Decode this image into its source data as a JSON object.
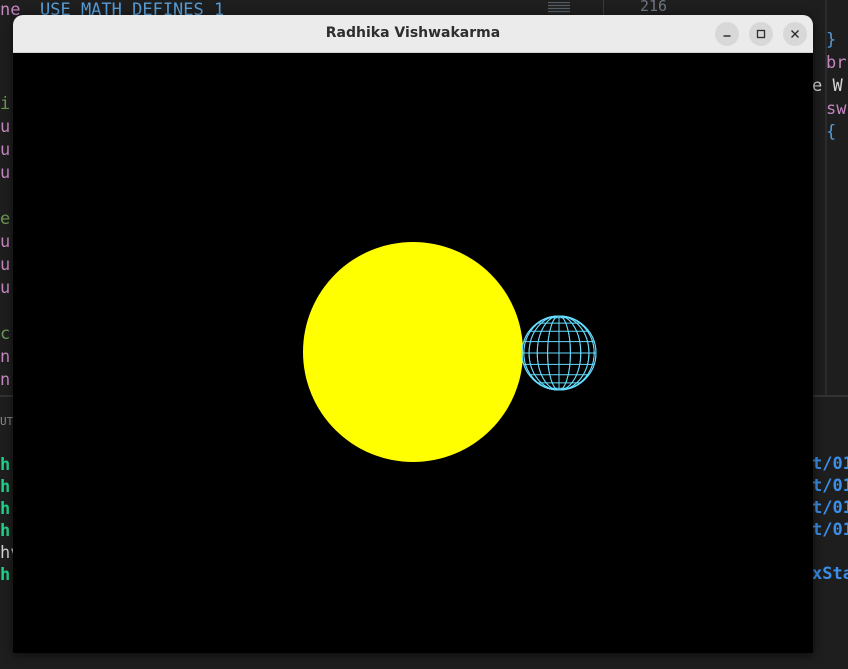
{
  "window": {
    "title": "Radhika Vishwakarma",
    "controls": {
      "minimize": "minimize-icon",
      "maximize": "maximize-icon",
      "close": "close-icon"
    }
  },
  "scene": {
    "background_color": "#000000",
    "sun": {
      "color": "#ffff00",
      "style": "solid"
    },
    "planet": {
      "color": "#66ddff",
      "style": "wireframe"
    }
  },
  "background_editor": {
    "top_line_fragments": [
      "ne",
      "USE MATH DEFINES 1"
    ],
    "top_right_number": "216",
    "left_fragments": [
      "u",
      "i",
      "u",
      "u",
      "u",
      "e",
      "u",
      "u",
      "u",
      "c",
      "n",
      "n"
    ],
    "right_fragments": [
      "}",
      "br",
      "e W",
      "sw",
      "{"
    ],
    "terminal_left_fragments": [
      "UT",
      "h:",
      "h:",
      "h:",
      "h:",
      "hv",
      "h:"
    ],
    "terminal_right_fragments": [
      "t/01",
      "t/01",
      "t/01",
      "t/01",
      "xSta"
    ]
  }
}
